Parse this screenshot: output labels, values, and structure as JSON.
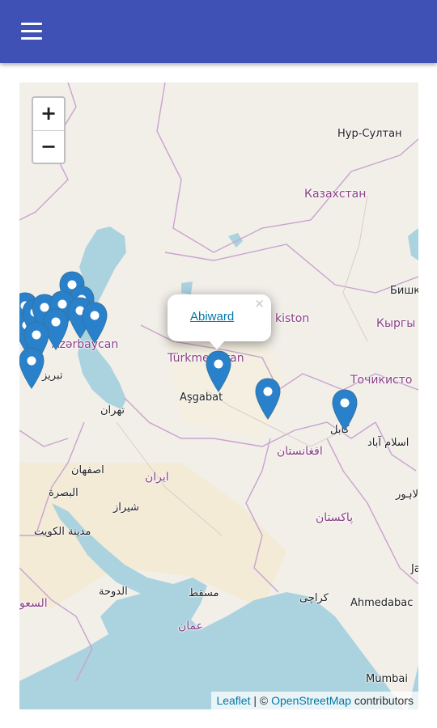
{
  "app_bar": {
    "menu_icon": "hamburger-menu-icon",
    "color": "#3f51b5"
  },
  "map": {
    "zoom_in": "+",
    "zoom_out": "−",
    "marker_color": "#2a81cb",
    "labels": {
      "nur_sultan": "Нур-Султан",
      "kazakhstan": "Казахстан",
      "bishkek": "Бишк",
      "kyrgyzstan": "Кыргы",
      "uzbekistan": "kiston",
      "azerbaijan": "Azərbaycan",
      "turkmenistan": "Türkmenistan",
      "ashgabat": "Aşgabat",
      "tajikistan": "Точикисто",
      "tabriz": "تبریز",
      "tehran": "تهران",
      "afghanistan": "افغانستان",
      "kabul": "کابل",
      "islamabad": "اسلام آباد",
      "isfahan": "اصفهان",
      "iran": "ایران",
      "basra": "البصرة",
      "shiraz": "شیراز",
      "kuwait": "مدينة الكويت",
      "lahore": "لاہور",
      "pakistan": "پاکستان",
      "doha": "الدوحة",
      "muscat": "مسقط",
      "karachi": "کراچی",
      "saudi": "السعو",
      "oman": "عمان",
      "ahmedabad": "Ahmedabac",
      "mumbai": "Mumbai",
      "ja": "Ja"
    },
    "popup": {
      "title": "Abiward",
      "close": "×"
    },
    "attribution": {
      "leaflet": "Leaflet",
      "separator": " | © ",
      "osm": "OpenStreetMap",
      "contributors": " contributors"
    }
  }
}
